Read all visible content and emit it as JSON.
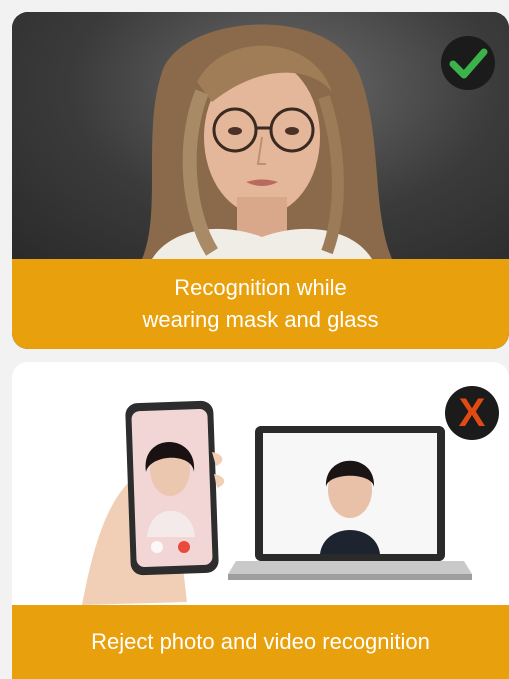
{
  "top_card": {
    "caption_line1": "Recognition while",
    "caption_line2": "wearing mask and glass",
    "badge_icon": "check-icon",
    "badge_color": "#3cb24a"
  },
  "bottom_card": {
    "caption": "Reject photo and video recognition",
    "badge_icon": "x-icon",
    "badge_glyph": "X",
    "badge_color": "#e24a14"
  },
  "colors": {
    "caption_bg": "#e9a00d",
    "caption_text": "#ffffff"
  }
}
